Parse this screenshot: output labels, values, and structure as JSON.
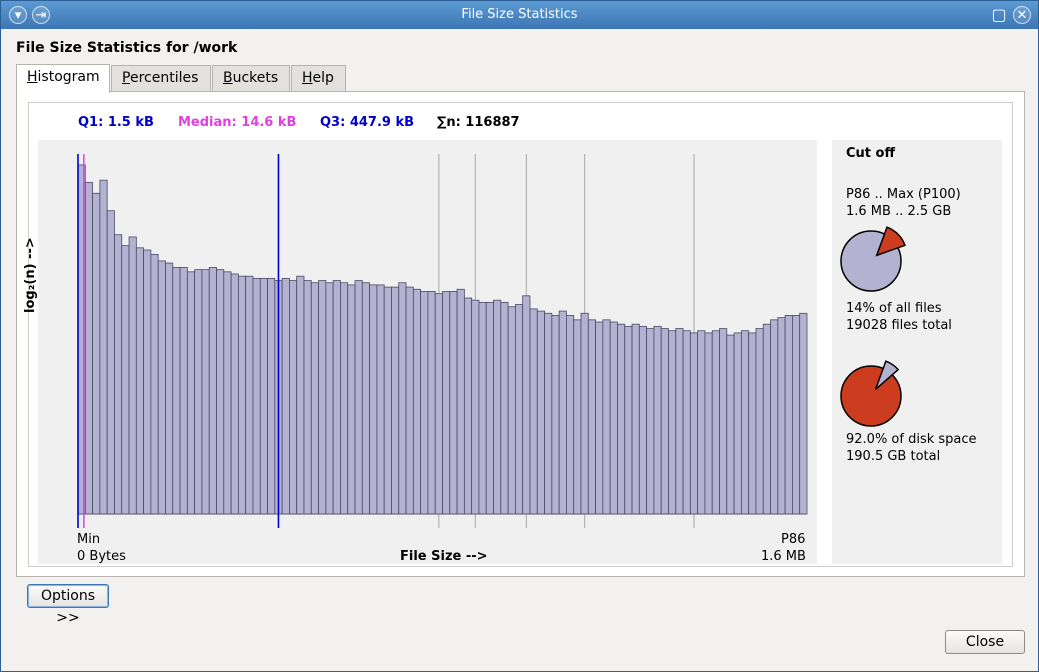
{
  "window": {
    "title": "File Size Statistics",
    "titlebar_buttons": [
      "menu-icon",
      "pin-icon",
      "maximize-icon",
      "close-icon"
    ]
  },
  "heading": "File Size Statistics for /work",
  "tabs": [
    {
      "label": "Histogram",
      "active": true
    },
    {
      "label": "Percentiles",
      "active": false
    },
    {
      "label": "Buckets",
      "active": false
    },
    {
      "label": "Help",
      "active": false
    }
  ],
  "stats": {
    "q1": "Q1: 1.5 kB",
    "median": "Median: 14.6 kB",
    "q3": "Q3: 447.9 kB",
    "n": "∑n: 116887"
  },
  "colors": {
    "q1": "#0000cc",
    "median": "#e040e0",
    "q3": "#0000cc",
    "bar_fill": "#b3b3d1",
    "bar_stroke": "#4a4a66",
    "pie_files": "#b3b3d1",
    "pie_space": "#cc3d1f"
  },
  "chart_data": {
    "type": "bar",
    "title": "",
    "xlabel": "File Size  -->",
    "ylabel": "log₂(n)  -->",
    "x_min_label": [
      "Min",
      "0 Bytes"
    ],
    "x_max_label": [
      "P86",
      "1.6 MB"
    ],
    "values": [
      16.0,
      15.2,
      14.7,
      15.3,
      13.9,
      12.8,
      12.3,
      12.7,
      12.2,
      12.1,
      11.9,
      11.6,
      11.5,
      11.3,
      11.3,
      11.1,
      11.2,
      11.2,
      11.3,
      11.2,
      11.1,
      11.0,
      10.9,
      10.9,
      10.8,
      10.8,
      10.8,
      10.7,
      10.8,
      10.7,
      10.9,
      10.7,
      10.6,
      10.7,
      10.6,
      10.7,
      10.6,
      10.5,
      10.7,
      10.6,
      10.5,
      10.5,
      10.4,
      10.4,
      10.6,
      10.4,
      10.3,
      10.2,
      10.2,
      10.1,
      10.2,
      10.2,
      10.3,
      9.9,
      9.8,
      9.7,
      9.7,
      9.8,
      9.7,
      9.5,
      9.6,
      10.0,
      9.4,
      9.3,
      9.2,
      9.1,
      9.3,
      9.1,
      8.9,
      9.2,
      8.9,
      8.8,
      8.9,
      8.8,
      8.7,
      8.6,
      8.7,
      8.6,
      8.5,
      8.6,
      8.5,
      8.4,
      8.5,
      8.4,
      8.3,
      8.4,
      8.3,
      8.4,
      8.5,
      8.2,
      8.3,
      8.4,
      8.3,
      8.5,
      8.7,
      8.9,
      9.0,
      9.1,
      9.1,
      9.2
    ],
    "markers": [
      {
        "name": "Min",
        "value_pos": 0
      },
      {
        "name": "Median",
        "value_pos": 0.8
      },
      {
        "name": "Q3",
        "value_pos": 27.5
      },
      {
        "name": "grid1",
        "value_pos": 49.5
      },
      {
        "name": "grid2",
        "value_pos": 54.5
      },
      {
        "name": "grid3",
        "value_pos": 61.5
      },
      {
        "name": "grid4",
        "value_pos": 69.5
      },
      {
        "name": "grid5",
        "value_pos": 84.5
      }
    ],
    "ylim": [
      0,
      16.5
    ],
    "grid": false
  },
  "cutoff": {
    "title": "Cut off",
    "range_label": "P86 .. Max (P100)",
    "range_values": "1.6 MB .. 2.5 GB",
    "files_pct": 14,
    "files_text": "14% of all files",
    "files_total": "19028 files total",
    "space_pct": 92.0,
    "space_text": "92.0% of disk space",
    "space_total": "190.5 GB total"
  },
  "buttons": {
    "options": "Options >>",
    "close": "Close"
  }
}
